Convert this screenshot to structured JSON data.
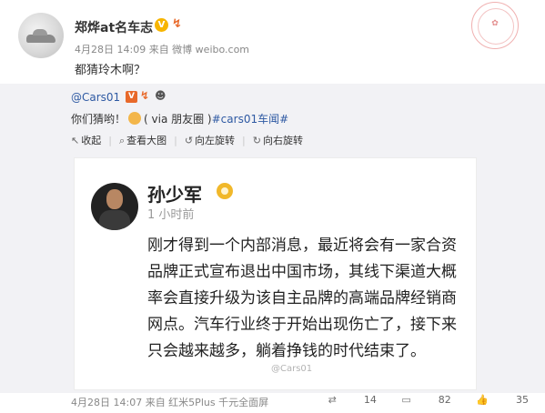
{
  "post": {
    "author": "郑烨at名车志",
    "meta": "4月28日 14:09 来自 微博 weibo.com",
    "text": "都猜玲木啊？"
  },
  "repost": {
    "author": "@Cars01",
    "text_prefix": "你们猜哟！",
    "via": "( via 朋友圈 )",
    "topic": "#cars01车闻#",
    "tools": [
      {
        "icon": "collapse-icon",
        "label": "收起"
      },
      {
        "icon": "zoom-icon",
        "label": "查看大图"
      },
      {
        "icon": "rotate-left-icon",
        "label": "向左旋转"
      },
      {
        "icon": "rotate-right-icon",
        "label": "向右旋转"
      }
    ]
  },
  "card": {
    "name": "孙少军",
    "time": "1 小时前",
    "lines": [
      "刚才得到一个内部消息，最近将会有一家合资",
      "品牌正式宣布退出中国市场，其线下渠道大概",
      "率会直接升级为该自主品牌的高端品牌经销商",
      "网点。汽车行业终于开始出现伤亡了，接下来",
      "只会越来越多，躺着挣钱的时代结束了。"
    ],
    "watermark": "@Cars01"
  },
  "footer": {
    "meta": "4月28日 14:07 来自 红米5Plus 千元全面屏",
    "repost_count": "14",
    "comment_count": "82",
    "like_count": "35"
  },
  "colors": {
    "link": "#2f5aa3",
    "repost_bg": "#f2f2f5",
    "badge_gold": "#f7b500"
  }
}
